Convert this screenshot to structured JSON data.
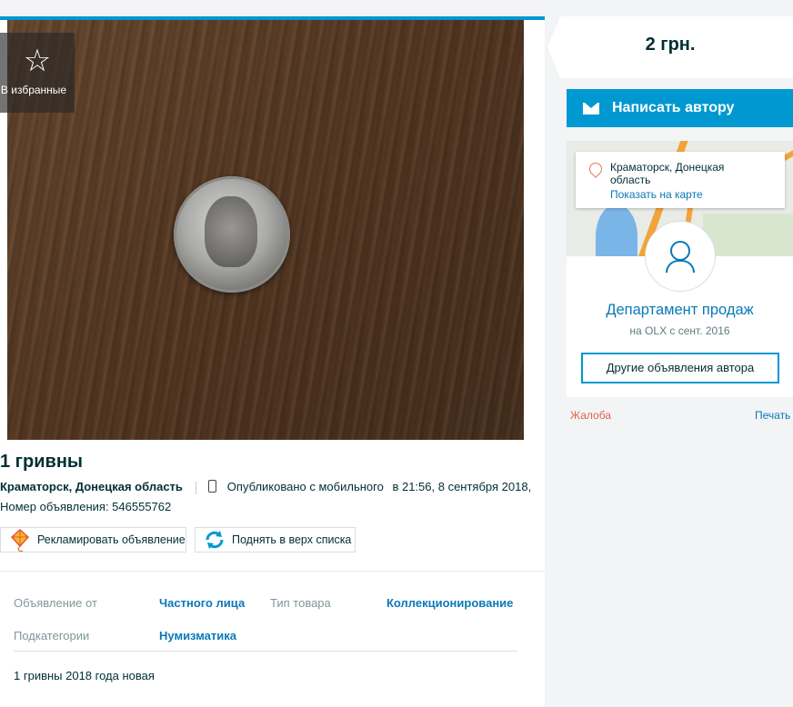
{
  "favorites": {
    "label": "В избранные",
    "icon": "star-icon"
  },
  "ad": {
    "title": "1 гривны",
    "location": "Краматорск, Донецкая область",
    "published": "Опубликовано с мобильного",
    "published_time": "в 21:56, 8 сентября 2018,",
    "ad_number": "Номер объявления: 546555762"
  },
  "actions": {
    "promote": "Рекламировать объявление",
    "bump": "Поднять в верх списка"
  },
  "attributes": [
    {
      "label": "Объявление от",
      "value": "Частного лица"
    },
    {
      "label": "Тип товара",
      "value": "Коллекционирование"
    },
    {
      "label": "Подкатегории",
      "value": "Нумизматика"
    }
  ],
  "description": "1 гривны 2018 года новая",
  "price": "2 грн.",
  "contact_button": "Написать автору",
  "map_popup": {
    "location": "Краматорск, Донецкая область",
    "show_on_map": "Показать на карте"
  },
  "author": {
    "name": "Департамент продаж",
    "since": "на OLX с сент. 2016",
    "other_ads": "Другие объявления автора"
  },
  "links": {
    "complaint": "Жалоба",
    "print": "Печать"
  },
  "colors": {
    "accent": "#0098d0",
    "link": "#0a79b8",
    "complaint": "#e0654b"
  }
}
